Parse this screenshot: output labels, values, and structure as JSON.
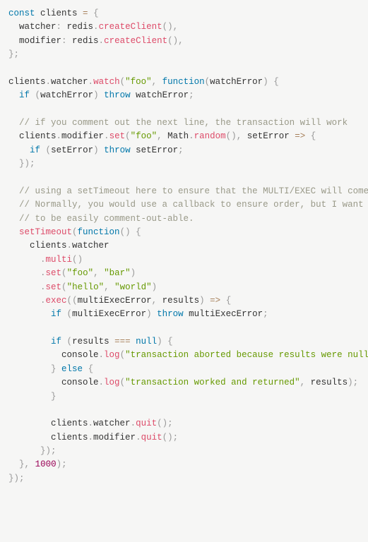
{
  "code": {
    "lines": [
      {
        "tokens": [
          {
            "t": "const",
            "c": "kw"
          },
          {
            "t": " clients ",
            "c": ""
          },
          {
            "t": "=",
            "c": "op"
          },
          {
            "t": " ",
            "c": ""
          },
          {
            "t": "{",
            "c": "pun"
          }
        ]
      },
      {
        "tokens": [
          {
            "t": "  watcher",
            "c": ""
          },
          {
            "t": ":",
            "c": "pun"
          },
          {
            "t": " redis",
            "c": ""
          },
          {
            "t": ".",
            "c": "pun"
          },
          {
            "t": "createClient",
            "c": "call"
          },
          {
            "t": "(",
            "c": "pun"
          },
          {
            "t": ")",
            "c": "pun"
          },
          {
            "t": ",",
            "c": "pun"
          }
        ]
      },
      {
        "tokens": [
          {
            "t": "  modifier",
            "c": ""
          },
          {
            "t": ":",
            "c": "pun"
          },
          {
            "t": " redis",
            "c": ""
          },
          {
            "t": ".",
            "c": "pun"
          },
          {
            "t": "createClient",
            "c": "call"
          },
          {
            "t": "(",
            "c": "pun"
          },
          {
            "t": ")",
            "c": "pun"
          },
          {
            "t": ",",
            "c": "pun"
          }
        ]
      },
      {
        "tokens": [
          {
            "t": "}",
            "c": "pun"
          },
          {
            "t": ";",
            "c": "pun"
          }
        ]
      },
      {
        "tokens": [
          {
            "t": " ",
            "c": ""
          }
        ]
      },
      {
        "tokens": [
          {
            "t": "clients",
            "c": ""
          },
          {
            "t": ".",
            "c": "pun"
          },
          {
            "t": "watcher",
            "c": ""
          },
          {
            "t": ".",
            "c": "pun"
          },
          {
            "t": "watch",
            "c": "call"
          },
          {
            "t": "(",
            "c": "pun"
          },
          {
            "t": "\"foo\"",
            "c": "str"
          },
          {
            "t": ",",
            "c": "pun"
          },
          {
            "t": " ",
            "c": ""
          },
          {
            "t": "function",
            "c": "kw"
          },
          {
            "t": "(",
            "c": "pun"
          },
          {
            "t": "watchError",
            "c": ""
          },
          {
            "t": ")",
            "c": "pun"
          },
          {
            "t": " ",
            "c": ""
          },
          {
            "t": "{",
            "c": "pun"
          }
        ]
      },
      {
        "tokens": [
          {
            "t": "  ",
            "c": ""
          },
          {
            "t": "if",
            "c": "kw"
          },
          {
            "t": " ",
            "c": ""
          },
          {
            "t": "(",
            "c": "pun"
          },
          {
            "t": "watchError",
            "c": ""
          },
          {
            "t": ")",
            "c": "pun"
          },
          {
            "t": " ",
            "c": ""
          },
          {
            "t": "throw",
            "c": "kw"
          },
          {
            "t": " watchError",
            "c": ""
          },
          {
            "t": ";",
            "c": "pun"
          }
        ]
      },
      {
        "tokens": [
          {
            "t": " ",
            "c": ""
          }
        ]
      },
      {
        "tokens": [
          {
            "t": "  ",
            "c": ""
          },
          {
            "t": "// if you comment out the next line, the transaction will work",
            "c": "cmt"
          }
        ]
      },
      {
        "tokens": [
          {
            "t": "  clients",
            "c": ""
          },
          {
            "t": ".",
            "c": "pun"
          },
          {
            "t": "modifier",
            "c": ""
          },
          {
            "t": ".",
            "c": "pun"
          },
          {
            "t": "set",
            "c": "call"
          },
          {
            "t": "(",
            "c": "pun"
          },
          {
            "t": "\"foo\"",
            "c": "str"
          },
          {
            "t": ",",
            "c": "pun"
          },
          {
            "t": " Math",
            "c": ""
          },
          {
            "t": ".",
            "c": "pun"
          },
          {
            "t": "random",
            "c": "call"
          },
          {
            "t": "(",
            "c": "pun"
          },
          {
            "t": ")",
            "c": "pun"
          },
          {
            "t": ",",
            "c": "pun"
          },
          {
            "t": " setError ",
            "c": ""
          },
          {
            "t": "=>",
            "c": "op"
          },
          {
            "t": " ",
            "c": ""
          },
          {
            "t": "{",
            "c": "pun"
          }
        ]
      },
      {
        "tokens": [
          {
            "t": "    ",
            "c": ""
          },
          {
            "t": "if",
            "c": "kw"
          },
          {
            "t": " ",
            "c": ""
          },
          {
            "t": "(",
            "c": "pun"
          },
          {
            "t": "setError",
            "c": ""
          },
          {
            "t": ")",
            "c": "pun"
          },
          {
            "t": " ",
            "c": ""
          },
          {
            "t": "throw",
            "c": "kw"
          },
          {
            "t": " setError",
            "c": ""
          },
          {
            "t": ";",
            "c": "pun"
          }
        ]
      },
      {
        "tokens": [
          {
            "t": "  ",
            "c": ""
          },
          {
            "t": "}",
            "c": "pun"
          },
          {
            "t": ")",
            "c": "pun"
          },
          {
            "t": ";",
            "c": "pun"
          }
        ]
      },
      {
        "tokens": [
          {
            "t": " ",
            "c": ""
          }
        ]
      },
      {
        "tokens": [
          {
            "t": "  ",
            "c": ""
          },
          {
            "t": "// using a setTimeout here to ensure that the MULTI/EXEC will come after the SET.",
            "c": "cmt"
          }
        ]
      },
      {
        "tokens": [
          {
            "t": "  ",
            "c": ""
          },
          {
            "t": "// Normally, you would use a callback to ensure order, but I want the above SET command",
            "c": "cmt"
          }
        ]
      },
      {
        "tokens": [
          {
            "t": "  ",
            "c": ""
          },
          {
            "t": "// to be easily comment-out-able.",
            "c": "cmt"
          }
        ]
      },
      {
        "tokens": [
          {
            "t": "  ",
            "c": ""
          },
          {
            "t": "setTimeout",
            "c": "call"
          },
          {
            "t": "(",
            "c": "pun"
          },
          {
            "t": "function",
            "c": "kw"
          },
          {
            "t": "(",
            "c": "pun"
          },
          {
            "t": ")",
            "c": "pun"
          },
          {
            "t": " ",
            "c": ""
          },
          {
            "t": "{",
            "c": "pun"
          }
        ]
      },
      {
        "tokens": [
          {
            "t": "    clients",
            "c": ""
          },
          {
            "t": ".",
            "c": "pun"
          },
          {
            "t": "watcher",
            "c": ""
          }
        ]
      },
      {
        "tokens": [
          {
            "t": "      ",
            "c": ""
          },
          {
            "t": ".",
            "c": "pun"
          },
          {
            "t": "multi",
            "c": "call"
          },
          {
            "t": "(",
            "c": "pun"
          },
          {
            "t": ")",
            "c": "pun"
          }
        ]
      },
      {
        "tokens": [
          {
            "t": "      ",
            "c": ""
          },
          {
            "t": ".",
            "c": "pun"
          },
          {
            "t": "set",
            "c": "call"
          },
          {
            "t": "(",
            "c": "pun"
          },
          {
            "t": "\"foo\"",
            "c": "str"
          },
          {
            "t": ",",
            "c": "pun"
          },
          {
            "t": " ",
            "c": ""
          },
          {
            "t": "\"bar\"",
            "c": "str"
          },
          {
            "t": ")",
            "c": "pun"
          }
        ]
      },
      {
        "tokens": [
          {
            "t": "      ",
            "c": ""
          },
          {
            "t": ".",
            "c": "pun"
          },
          {
            "t": "set",
            "c": "call"
          },
          {
            "t": "(",
            "c": "pun"
          },
          {
            "t": "\"hello\"",
            "c": "str"
          },
          {
            "t": ",",
            "c": "pun"
          },
          {
            "t": " ",
            "c": ""
          },
          {
            "t": "\"world\"",
            "c": "str"
          },
          {
            "t": ")",
            "c": "pun"
          }
        ]
      },
      {
        "tokens": [
          {
            "t": "      ",
            "c": ""
          },
          {
            "t": ".",
            "c": "pun"
          },
          {
            "t": "exec",
            "c": "call"
          },
          {
            "t": "(",
            "c": "pun"
          },
          {
            "t": "(",
            "c": "pun"
          },
          {
            "t": "multiExecError",
            "c": ""
          },
          {
            "t": ",",
            "c": "pun"
          },
          {
            "t": " results",
            "c": ""
          },
          {
            "t": ")",
            "c": "pun"
          },
          {
            "t": " ",
            "c": ""
          },
          {
            "t": "=>",
            "c": "op"
          },
          {
            "t": " ",
            "c": ""
          },
          {
            "t": "{",
            "c": "pun"
          }
        ]
      },
      {
        "tokens": [
          {
            "t": "        ",
            "c": ""
          },
          {
            "t": "if",
            "c": "kw"
          },
          {
            "t": " ",
            "c": ""
          },
          {
            "t": "(",
            "c": "pun"
          },
          {
            "t": "multiExecError",
            "c": ""
          },
          {
            "t": ")",
            "c": "pun"
          },
          {
            "t": " ",
            "c": ""
          },
          {
            "t": "throw",
            "c": "kw"
          },
          {
            "t": " multiExecError",
            "c": ""
          },
          {
            "t": ";",
            "c": "pun"
          }
        ]
      },
      {
        "tokens": [
          {
            "t": " ",
            "c": ""
          }
        ]
      },
      {
        "tokens": [
          {
            "t": "        ",
            "c": ""
          },
          {
            "t": "if",
            "c": "kw"
          },
          {
            "t": " ",
            "c": ""
          },
          {
            "t": "(",
            "c": "pun"
          },
          {
            "t": "results ",
            "c": ""
          },
          {
            "t": "===",
            "c": "op"
          },
          {
            "t": " ",
            "c": ""
          },
          {
            "t": "null",
            "c": "bool"
          },
          {
            "t": ")",
            "c": "pun"
          },
          {
            "t": " ",
            "c": ""
          },
          {
            "t": "{",
            "c": "pun"
          }
        ]
      },
      {
        "tokens": [
          {
            "t": "          console",
            "c": ""
          },
          {
            "t": ".",
            "c": "pun"
          },
          {
            "t": "log",
            "c": "call"
          },
          {
            "t": "(",
            "c": "pun"
          },
          {
            "t": "\"transaction aborted because results were null\"",
            "c": "str"
          },
          {
            "t": ")",
            "c": "pun"
          },
          {
            "t": ";",
            "c": "pun"
          }
        ]
      },
      {
        "tokens": [
          {
            "t": "        ",
            "c": ""
          },
          {
            "t": "}",
            "c": "pun"
          },
          {
            "t": " ",
            "c": ""
          },
          {
            "t": "else",
            "c": "kw"
          },
          {
            "t": " ",
            "c": ""
          },
          {
            "t": "{",
            "c": "pun"
          }
        ]
      },
      {
        "tokens": [
          {
            "t": "          console",
            "c": ""
          },
          {
            "t": ".",
            "c": "pun"
          },
          {
            "t": "log",
            "c": "call"
          },
          {
            "t": "(",
            "c": "pun"
          },
          {
            "t": "\"transaction worked and returned\"",
            "c": "str"
          },
          {
            "t": ",",
            "c": "pun"
          },
          {
            "t": " results",
            "c": ""
          },
          {
            "t": ")",
            "c": "pun"
          },
          {
            "t": ";",
            "c": "pun"
          }
        ]
      },
      {
        "tokens": [
          {
            "t": "        ",
            "c": ""
          },
          {
            "t": "}",
            "c": "pun"
          }
        ]
      },
      {
        "tokens": [
          {
            "t": " ",
            "c": ""
          }
        ]
      },
      {
        "tokens": [
          {
            "t": "        clients",
            "c": ""
          },
          {
            "t": ".",
            "c": "pun"
          },
          {
            "t": "watcher",
            "c": ""
          },
          {
            "t": ".",
            "c": "pun"
          },
          {
            "t": "quit",
            "c": "call"
          },
          {
            "t": "(",
            "c": "pun"
          },
          {
            "t": ")",
            "c": "pun"
          },
          {
            "t": ";",
            "c": "pun"
          }
        ]
      },
      {
        "tokens": [
          {
            "t": "        clients",
            "c": ""
          },
          {
            "t": ".",
            "c": "pun"
          },
          {
            "t": "modifier",
            "c": ""
          },
          {
            "t": ".",
            "c": "pun"
          },
          {
            "t": "quit",
            "c": "call"
          },
          {
            "t": "(",
            "c": "pun"
          },
          {
            "t": ")",
            "c": "pun"
          },
          {
            "t": ";",
            "c": "pun"
          }
        ]
      },
      {
        "tokens": [
          {
            "t": "      ",
            "c": ""
          },
          {
            "t": "}",
            "c": "pun"
          },
          {
            "t": ")",
            "c": "pun"
          },
          {
            "t": ";",
            "c": "pun"
          }
        ]
      },
      {
        "tokens": [
          {
            "t": "  ",
            "c": ""
          },
          {
            "t": "}",
            "c": "pun"
          },
          {
            "t": ",",
            "c": "pun"
          },
          {
            "t": " ",
            "c": ""
          },
          {
            "t": "1000",
            "c": "num"
          },
          {
            "t": ")",
            "c": "pun"
          },
          {
            "t": ";",
            "c": "pun"
          }
        ]
      },
      {
        "tokens": [
          {
            "t": "}",
            "c": "pun"
          },
          {
            "t": ")",
            "c": "pun"
          },
          {
            "t": ";",
            "c": "pun"
          }
        ]
      }
    ]
  }
}
